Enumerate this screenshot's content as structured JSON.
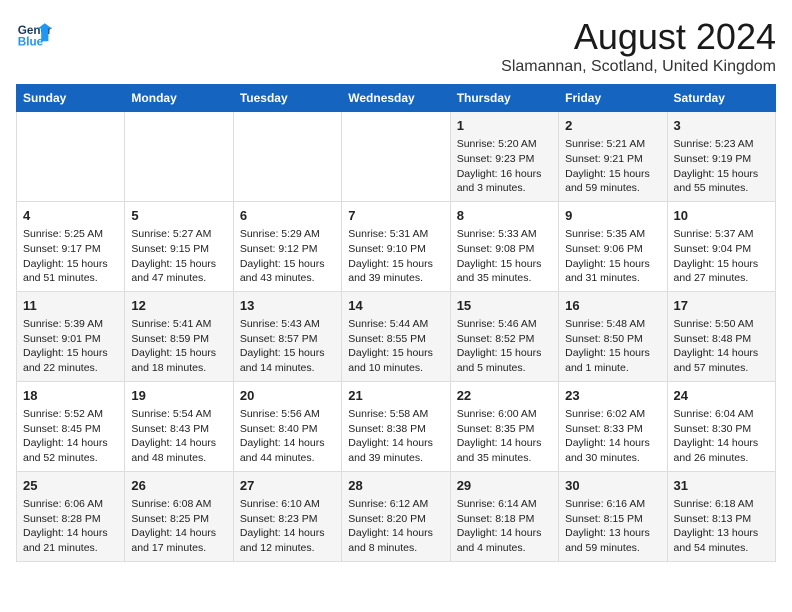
{
  "header": {
    "logo_general": "General",
    "logo_blue": "Blue",
    "month_title": "August 2024",
    "location": "Slamannan, Scotland, United Kingdom"
  },
  "weekdays": [
    "Sunday",
    "Monday",
    "Tuesday",
    "Wednesday",
    "Thursday",
    "Friday",
    "Saturday"
  ],
  "weeks": [
    [
      {
        "day": "",
        "info": ""
      },
      {
        "day": "",
        "info": ""
      },
      {
        "day": "",
        "info": ""
      },
      {
        "day": "",
        "info": ""
      },
      {
        "day": "1",
        "info": "Sunrise: 5:20 AM\nSunset: 9:23 PM\nDaylight: 16 hours\nand 3 minutes."
      },
      {
        "day": "2",
        "info": "Sunrise: 5:21 AM\nSunset: 9:21 PM\nDaylight: 15 hours\nand 59 minutes."
      },
      {
        "day": "3",
        "info": "Sunrise: 5:23 AM\nSunset: 9:19 PM\nDaylight: 15 hours\nand 55 minutes."
      }
    ],
    [
      {
        "day": "4",
        "info": "Sunrise: 5:25 AM\nSunset: 9:17 PM\nDaylight: 15 hours\nand 51 minutes."
      },
      {
        "day": "5",
        "info": "Sunrise: 5:27 AM\nSunset: 9:15 PM\nDaylight: 15 hours\nand 47 minutes."
      },
      {
        "day": "6",
        "info": "Sunrise: 5:29 AM\nSunset: 9:12 PM\nDaylight: 15 hours\nand 43 minutes."
      },
      {
        "day": "7",
        "info": "Sunrise: 5:31 AM\nSunset: 9:10 PM\nDaylight: 15 hours\nand 39 minutes."
      },
      {
        "day": "8",
        "info": "Sunrise: 5:33 AM\nSunset: 9:08 PM\nDaylight: 15 hours\nand 35 minutes."
      },
      {
        "day": "9",
        "info": "Sunrise: 5:35 AM\nSunset: 9:06 PM\nDaylight: 15 hours\nand 31 minutes."
      },
      {
        "day": "10",
        "info": "Sunrise: 5:37 AM\nSunset: 9:04 PM\nDaylight: 15 hours\nand 27 minutes."
      }
    ],
    [
      {
        "day": "11",
        "info": "Sunrise: 5:39 AM\nSunset: 9:01 PM\nDaylight: 15 hours\nand 22 minutes."
      },
      {
        "day": "12",
        "info": "Sunrise: 5:41 AM\nSunset: 8:59 PM\nDaylight: 15 hours\nand 18 minutes."
      },
      {
        "day": "13",
        "info": "Sunrise: 5:43 AM\nSunset: 8:57 PM\nDaylight: 15 hours\nand 14 minutes."
      },
      {
        "day": "14",
        "info": "Sunrise: 5:44 AM\nSunset: 8:55 PM\nDaylight: 15 hours\nand 10 minutes."
      },
      {
        "day": "15",
        "info": "Sunrise: 5:46 AM\nSunset: 8:52 PM\nDaylight: 15 hours\nand 5 minutes."
      },
      {
        "day": "16",
        "info": "Sunrise: 5:48 AM\nSunset: 8:50 PM\nDaylight: 15 hours\nand 1 minute."
      },
      {
        "day": "17",
        "info": "Sunrise: 5:50 AM\nSunset: 8:48 PM\nDaylight: 14 hours\nand 57 minutes."
      }
    ],
    [
      {
        "day": "18",
        "info": "Sunrise: 5:52 AM\nSunset: 8:45 PM\nDaylight: 14 hours\nand 52 minutes."
      },
      {
        "day": "19",
        "info": "Sunrise: 5:54 AM\nSunset: 8:43 PM\nDaylight: 14 hours\nand 48 minutes."
      },
      {
        "day": "20",
        "info": "Sunrise: 5:56 AM\nSunset: 8:40 PM\nDaylight: 14 hours\nand 44 minutes."
      },
      {
        "day": "21",
        "info": "Sunrise: 5:58 AM\nSunset: 8:38 PM\nDaylight: 14 hours\nand 39 minutes."
      },
      {
        "day": "22",
        "info": "Sunrise: 6:00 AM\nSunset: 8:35 PM\nDaylight: 14 hours\nand 35 minutes."
      },
      {
        "day": "23",
        "info": "Sunrise: 6:02 AM\nSunset: 8:33 PM\nDaylight: 14 hours\nand 30 minutes."
      },
      {
        "day": "24",
        "info": "Sunrise: 6:04 AM\nSunset: 8:30 PM\nDaylight: 14 hours\nand 26 minutes."
      }
    ],
    [
      {
        "day": "25",
        "info": "Sunrise: 6:06 AM\nSunset: 8:28 PM\nDaylight: 14 hours\nand 21 minutes."
      },
      {
        "day": "26",
        "info": "Sunrise: 6:08 AM\nSunset: 8:25 PM\nDaylight: 14 hours\nand 17 minutes."
      },
      {
        "day": "27",
        "info": "Sunrise: 6:10 AM\nSunset: 8:23 PM\nDaylight: 14 hours\nand 12 minutes."
      },
      {
        "day": "28",
        "info": "Sunrise: 6:12 AM\nSunset: 8:20 PM\nDaylight: 14 hours\nand 8 minutes."
      },
      {
        "day": "29",
        "info": "Sunrise: 6:14 AM\nSunset: 8:18 PM\nDaylight: 14 hours\nand 4 minutes."
      },
      {
        "day": "30",
        "info": "Sunrise: 6:16 AM\nSunset: 8:15 PM\nDaylight: 13 hours\nand 59 minutes."
      },
      {
        "day": "31",
        "info": "Sunrise: 6:18 AM\nSunset: 8:13 PM\nDaylight: 13 hours\nand 54 minutes."
      }
    ]
  ]
}
